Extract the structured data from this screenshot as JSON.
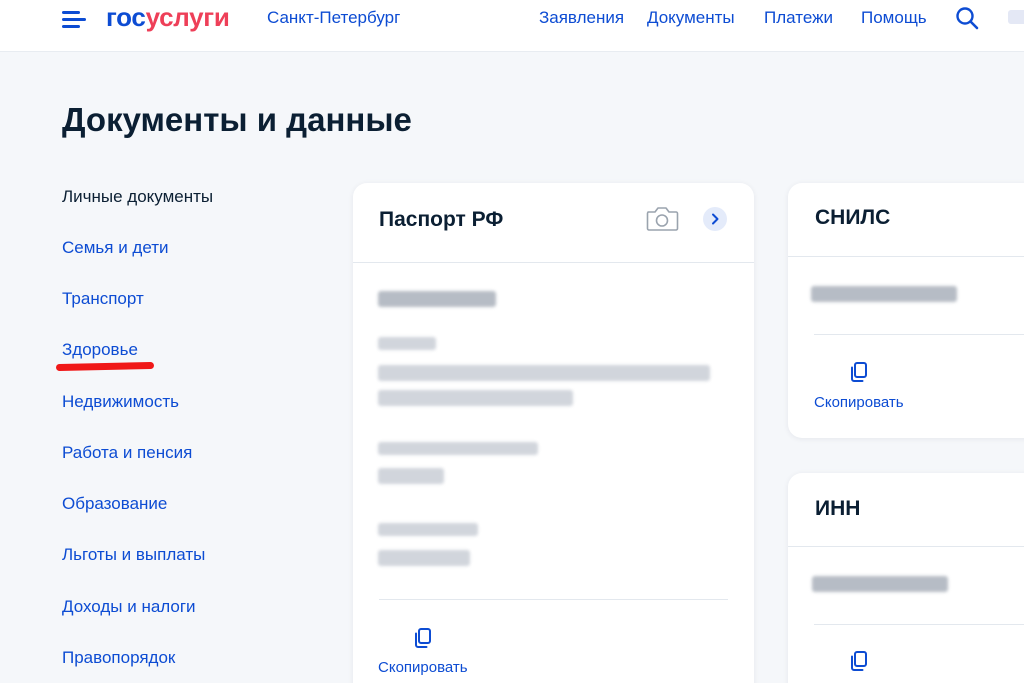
{
  "header": {
    "logo_part1": "гос",
    "logo_part2": "услуги",
    "city": "Санкт-Петербург",
    "nav": [
      "Заявления",
      "Документы",
      "Платежи",
      "Помощь"
    ]
  },
  "page": {
    "title": "Документы и данные"
  },
  "sidebar": {
    "items": [
      {
        "label": "Личные документы",
        "active": true
      },
      {
        "label": "Семья и дети"
      },
      {
        "label": "Транспорт"
      },
      {
        "label": "Здоровье",
        "highlighted": true
      },
      {
        "label": "Недвижимость"
      },
      {
        "label": "Работа и пенсия"
      },
      {
        "label": "Образование"
      },
      {
        "label": "Льготы и выплаты"
      },
      {
        "label": "Доходы и налоги"
      },
      {
        "label": "Правопорядок"
      }
    ]
  },
  "cards": {
    "passport": {
      "title": "Паспорт РФ",
      "copy_label": "Скопировать"
    },
    "snils": {
      "title": "СНИЛС",
      "copy_label": "Скопировать"
    },
    "inn": {
      "title": "ИНН"
    }
  },
  "colors": {
    "brand_blue": "#0d4cd3",
    "brand_red": "#ee3f58",
    "text_dark": "#0b1f33",
    "highlight_mark": "#f01818"
  },
  "icons": {
    "menu": "burger-menu-icon",
    "search": "search-icon",
    "camera": "camera-icon",
    "chevron": "chevron-right-icon",
    "copy": "copy-icon"
  }
}
